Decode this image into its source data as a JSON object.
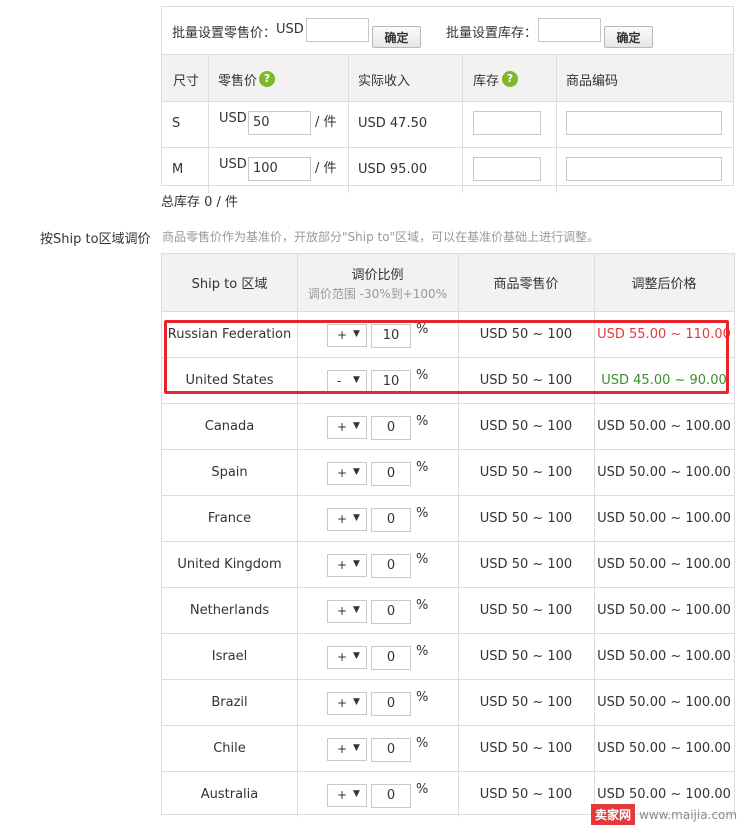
{
  "batch": {
    "price_label": "批量设置零售价：",
    "currency": "USD",
    "price_value": "",
    "confirm_label": "确定",
    "stock_label": "批量设置库存：",
    "stock_value": ""
  },
  "sku_table": {
    "headers": [
      "尺寸",
      "零售价",
      "实际收入",
      "库存",
      "商品编码"
    ],
    "help_glyph": "?",
    "per_unit": "/ 件",
    "rows": [
      {
        "size": "S",
        "currency": "USD",
        "price": "50",
        "income": "USD 47.50",
        "stock": "",
        "code": ""
      },
      {
        "size": "M",
        "currency": "USD",
        "price": "100",
        "income": "USD 95.00",
        "stock": "",
        "code": ""
      }
    ]
  },
  "total_stock": "总库存 0 / 件",
  "region": {
    "label": "按Ship to区域调价",
    "description": "商品零售价作为基准价，开放部分\"Ship to\"区域，可以在基准价基础上进行调整。",
    "headers": {
      "region": "Ship to 区域",
      "ratio": "调价比例",
      "ratio_range": "调价范围 -30%到+100%",
      "base_price": "商品零售价",
      "adjusted": "调整后价格"
    },
    "percent_sign": "%",
    "arrow_glyph": "▼",
    "rows": [
      {
        "name": "Russian Federation",
        "sign": "+",
        "pct": "10",
        "base": "USD 50 ~ 100",
        "adjusted": "USD 55.00 ~ 110.00",
        "tone": "red"
      },
      {
        "name": "United States",
        "sign": "-",
        "pct": "10",
        "base": "USD 50 ~ 100",
        "adjusted": "USD 45.00 ~ 90.00",
        "tone": "green"
      },
      {
        "name": "Canada",
        "sign": "+",
        "pct": "0",
        "base": "USD 50 ~ 100",
        "adjusted": "USD 50.00 ~ 100.00",
        "tone": "normal"
      },
      {
        "name": "Spain",
        "sign": "+",
        "pct": "0",
        "base": "USD 50 ~ 100",
        "adjusted": "USD 50.00 ~ 100.00",
        "tone": "normal"
      },
      {
        "name": "France",
        "sign": "+",
        "pct": "0",
        "base": "USD 50 ~ 100",
        "adjusted": "USD 50.00 ~ 100.00",
        "tone": "normal"
      },
      {
        "name": "United Kingdom",
        "sign": "+",
        "pct": "0",
        "base": "USD 50 ~ 100",
        "adjusted": "USD 50.00 ~ 100.00",
        "tone": "normal"
      },
      {
        "name": "Netherlands",
        "sign": "+",
        "pct": "0",
        "base": "USD 50 ~ 100",
        "adjusted": "USD 50.00 ~ 100.00",
        "tone": "normal"
      },
      {
        "name": "Israel",
        "sign": "+",
        "pct": "0",
        "base": "USD 50 ~ 100",
        "adjusted": "USD 50.00 ~ 100.00",
        "tone": "normal"
      },
      {
        "name": "Brazil",
        "sign": "+",
        "pct": "0",
        "base": "USD 50 ~ 100",
        "adjusted": "USD 50.00 ~ 100.00",
        "tone": "normal"
      },
      {
        "name": "Chile",
        "sign": "+",
        "pct": "0",
        "base": "USD 50 ~ 100",
        "adjusted": "USD 50.00 ~ 100.00",
        "tone": "normal"
      },
      {
        "name": "Australia",
        "sign": "+",
        "pct": "0",
        "base": "USD 50 ~ 100",
        "adjusted": "USD 50.00 ~ 100.00",
        "tone": "normal"
      }
    ]
  },
  "colors": {
    "increase": "#e4393c",
    "decrease": "#3a8f2c",
    "help_icon": "#7cb828",
    "highlight": "#e8232a"
  },
  "watermark": {
    "logo": "卖家网",
    "url": "www.maijia.com"
  }
}
